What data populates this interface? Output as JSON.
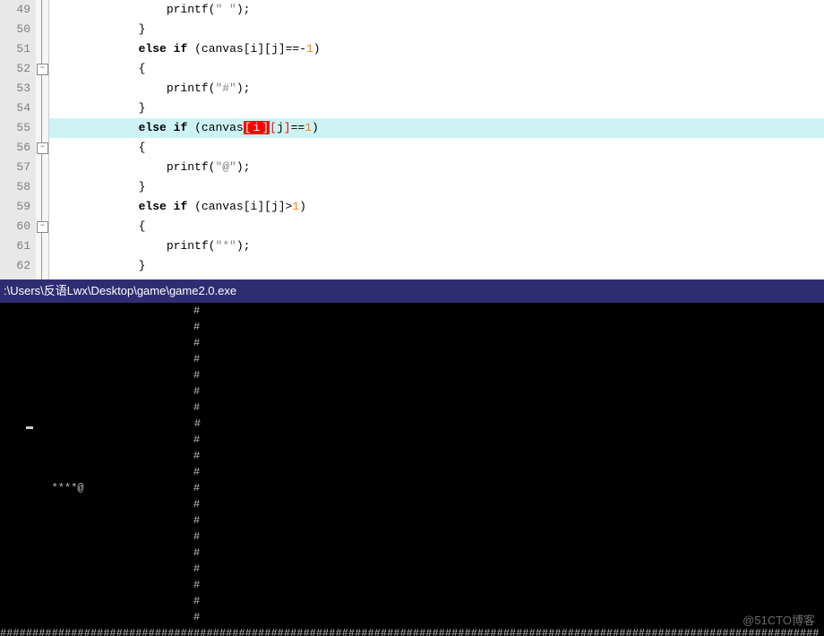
{
  "editor": {
    "lines": [
      {
        "num": "49",
        "indent": "                ",
        "tokens": [
          {
            "t": "fn",
            "v": "printf"
          },
          {
            "t": "paren",
            "v": "("
          },
          {
            "t": "str",
            "v": "\" \""
          },
          {
            "t": "paren",
            "v": ")"
          },
          {
            "t": "op",
            "v": ";"
          }
        ]
      },
      {
        "num": "50",
        "indent": "            ",
        "tokens": [
          {
            "t": "brace",
            "v": "}"
          }
        ]
      },
      {
        "num": "51",
        "indent": "            ",
        "tokens": [
          {
            "t": "kw",
            "v": "else"
          },
          {
            "t": "sp",
            "v": " "
          },
          {
            "t": "kw",
            "v": "if"
          },
          {
            "t": "sp",
            "v": " "
          },
          {
            "t": "paren",
            "v": "("
          },
          {
            "t": "ident",
            "v": "canvas"
          },
          {
            "t": "op",
            "v": "["
          },
          {
            "t": "ident",
            "v": "i"
          },
          {
            "t": "op",
            "v": "]["
          },
          {
            "t": "ident",
            "v": "j"
          },
          {
            "t": "op",
            "v": "]"
          },
          {
            "t": "op",
            "v": "==-"
          },
          {
            "t": "num",
            "v": "1"
          },
          {
            "t": "paren",
            "v": ")"
          }
        ]
      },
      {
        "num": "52",
        "indent": "            ",
        "fold": true,
        "tokens": [
          {
            "t": "brace",
            "v": "{"
          }
        ]
      },
      {
        "num": "53",
        "indent": "                ",
        "tokens": [
          {
            "t": "fn",
            "v": "printf"
          },
          {
            "t": "paren",
            "v": "("
          },
          {
            "t": "str",
            "v": "\"#\""
          },
          {
            "t": "paren",
            "v": ")"
          },
          {
            "t": "op",
            "v": ";"
          }
        ]
      },
      {
        "num": "54",
        "indent": "            ",
        "tokens": [
          {
            "t": "brace",
            "v": "}"
          }
        ]
      },
      {
        "num": "55",
        "indent": "            ",
        "hl": true,
        "tokens": [
          {
            "t": "kw",
            "v": "else"
          },
          {
            "t": "sp",
            "v": " "
          },
          {
            "t": "kw",
            "v": "if"
          },
          {
            "t": "sp",
            "v": " "
          },
          {
            "t": "paren",
            "v": "("
          },
          {
            "t": "ident",
            "v": "canvas"
          },
          {
            "t": "selopen",
            "v": "["
          },
          {
            "t": "selin",
            "v": "i"
          },
          {
            "t": "selclose",
            "v": "]"
          },
          {
            "t": "red",
            "v": "["
          },
          {
            "t": "ident",
            "v": "j"
          },
          {
            "t": "red",
            "v": "]"
          },
          {
            "t": "op",
            "v": "=="
          },
          {
            "t": "num",
            "v": "1"
          },
          {
            "t": "paren",
            "v": ")"
          }
        ]
      },
      {
        "num": "56",
        "indent": "            ",
        "fold": true,
        "tokens": [
          {
            "t": "brace",
            "v": "{"
          }
        ]
      },
      {
        "num": "57",
        "indent": "                ",
        "tokens": [
          {
            "t": "fn",
            "v": "printf"
          },
          {
            "t": "paren",
            "v": "("
          },
          {
            "t": "str",
            "v": "\"@\""
          },
          {
            "t": "paren",
            "v": ")"
          },
          {
            "t": "op",
            "v": ";"
          }
        ]
      },
      {
        "num": "58",
        "indent": "            ",
        "tokens": [
          {
            "t": "brace",
            "v": "}"
          }
        ]
      },
      {
        "num": "59",
        "indent": "            ",
        "tokens": [
          {
            "t": "kw",
            "v": "else"
          },
          {
            "t": "sp",
            "v": " "
          },
          {
            "t": "kw",
            "v": "if"
          },
          {
            "t": "sp",
            "v": " "
          },
          {
            "t": "paren",
            "v": "("
          },
          {
            "t": "ident",
            "v": "canvas"
          },
          {
            "t": "op",
            "v": "["
          },
          {
            "t": "ident",
            "v": "i"
          },
          {
            "t": "op",
            "v": "]["
          },
          {
            "t": "ident",
            "v": "j"
          },
          {
            "t": "op",
            "v": "]>"
          },
          {
            "t": "num",
            "v": "1"
          },
          {
            "t": "paren",
            "v": ")"
          }
        ]
      },
      {
        "num": "60",
        "indent": "            ",
        "fold": true,
        "tokens": [
          {
            "t": "brace",
            "v": "{"
          }
        ]
      },
      {
        "num": "61",
        "indent": "                ",
        "tokens": [
          {
            "t": "fn",
            "v": "printf"
          },
          {
            "t": "paren",
            "v": "("
          },
          {
            "t": "str",
            "v": "\"*\""
          },
          {
            "t": "paren",
            "v": ")"
          },
          {
            "t": "op",
            "v": ";"
          }
        ]
      },
      {
        "num": "62",
        "indent": "            ",
        "tokens": [
          {
            "t": "brace",
            "v": "}"
          }
        ]
      }
    ]
  },
  "console": {
    "title": ":\\Users\\反语Lwx\\Desktop\\game\\game2.0.exe",
    "wall_col": 30,
    "wall_char": "#",
    "rows": 20,
    "cursor_row": 7,
    "cursor_col": 4,
    "snake": {
      "row": 11,
      "text": "        ****@"
    },
    "bottom_row": "###############################################################################################################################"
  },
  "watermark": "@51CTO博客"
}
